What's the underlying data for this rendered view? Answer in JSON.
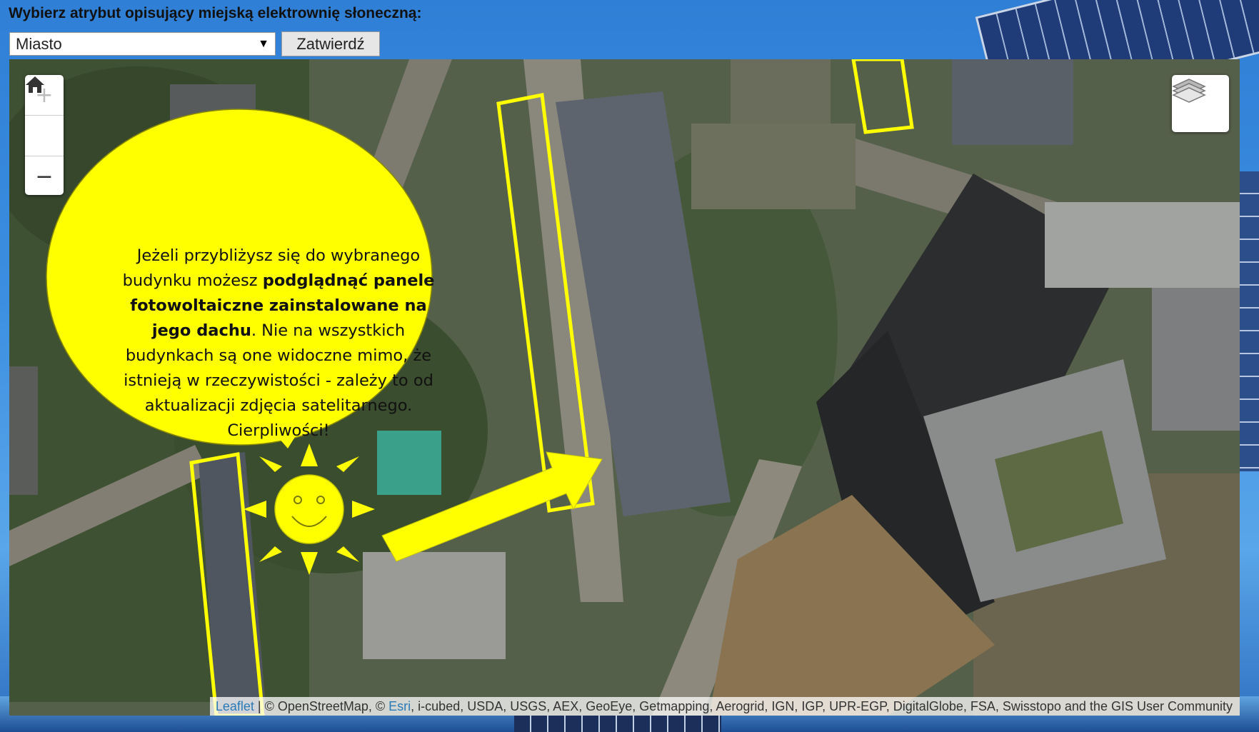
{
  "header": {
    "title": "Wybierz atrybut opisujący miejską elektrownię słoneczną:"
  },
  "form": {
    "select_value": "Miasto",
    "submit_label": "Zatwierdź"
  },
  "map_controls": {
    "zoom_in": "+",
    "zoom_out": "−",
    "home_icon": "home-icon",
    "layers_icon": "layers-icon"
  },
  "bubble": {
    "line1": "Jeżeli przybliżysz się do wybranego budynku możesz",
    "bold": "podglądnąć panele fotowoltaiczne zainstalowane na jego dachu",
    "line2": ". Nie na wszystkich budynkach są one widoczne mimo, że istnieją w rzeczywistości -  zależy to od aktualizacji zdjęcia satelitarnego. Cierpliwości!"
  },
  "attribution": {
    "leaflet": "Leaflet",
    "sep": " | © OpenStreetMap, © ",
    "esri": "Esri",
    "rest": ", i-cubed, USDA, USGS, AEX, GeoEye, Getmapping, Aerogrid, IGN, IGP, UPR-EGP, DigitalGlobe, FSA, Swisstopo and the GIS User Community"
  },
  "colors": {
    "highlight": "#ffff00",
    "page_background": "#3b8ee0"
  }
}
